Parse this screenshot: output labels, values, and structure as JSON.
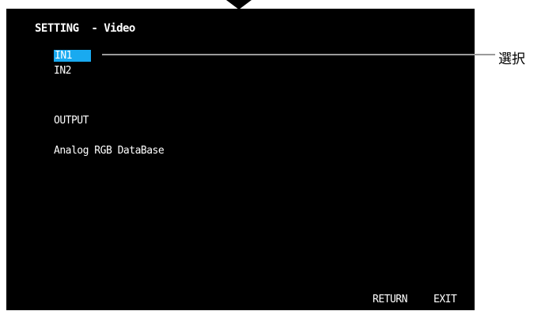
{
  "screen": {
    "title": "SETTING  - Video",
    "inputs": [
      {
        "label": "IN1",
        "selected": true
      },
      {
        "label": "IN2",
        "selected": false
      }
    ],
    "output_label": "OUTPUT",
    "database_label": "Analog RGB DataBase",
    "footer": {
      "return_label": "RETURN",
      "exit_label": "EXIT"
    }
  },
  "annotation": {
    "label": "選択"
  },
  "colors": {
    "screen_background": "#000000",
    "selection_highlight": "#19aaf0",
    "callout_line": "#9a9a9a",
    "text": "#ffffff"
  }
}
